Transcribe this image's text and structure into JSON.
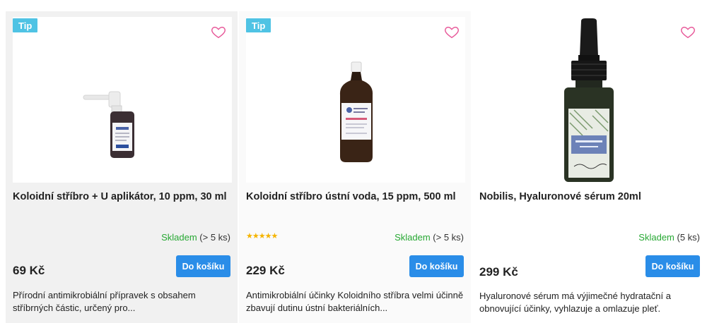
{
  "colors": {
    "badge": "#4fc3e4",
    "button": "#2a8de8",
    "heart": "#e85a9a",
    "in_stock": "#27a833",
    "stars": "#f5b400"
  },
  "products": [
    {
      "badge": "Tip",
      "title": "Koloidní stříbro + U aplikátor, 10 ppm, 30 ml",
      "rating_stars": null,
      "stock_label": "Skladem",
      "stock_count": "(> 5 ks)",
      "price": "69 Kč",
      "button_label": "Do košíku",
      "description": "Přírodní antimikrobiální přípravek s obsahem stříbrných částic, určený pro...",
      "icon": "heart-icon"
    },
    {
      "badge": "Tip",
      "title": "Koloidní stříbro ústní voda, 15 ppm, 500 ml",
      "rating_stars": "★★★★★",
      "stock_label": "Skladem",
      "stock_count": "(> 5 ks)",
      "price": "229 Kč",
      "button_label": "Do košíku",
      "description": "Antimikrobiální účinky Koloidního stříbra velmi účinně zbavují dutinu ústní bakteriálních...",
      "icon": "heart-icon"
    },
    {
      "badge": null,
      "title": "Nobilis, Hyaluronové sérum 20ml",
      "rating_stars": null,
      "stock_label": "Skladem",
      "stock_count": "(5 ks)",
      "price": "299 Kč",
      "button_label": "Do košíku",
      "description": "Hyaluronové sérum má výjimečné hydratační a obnovující účinky, vyhlazuje a omlazuje pleť.",
      "icon": "heart-icon"
    }
  ]
}
